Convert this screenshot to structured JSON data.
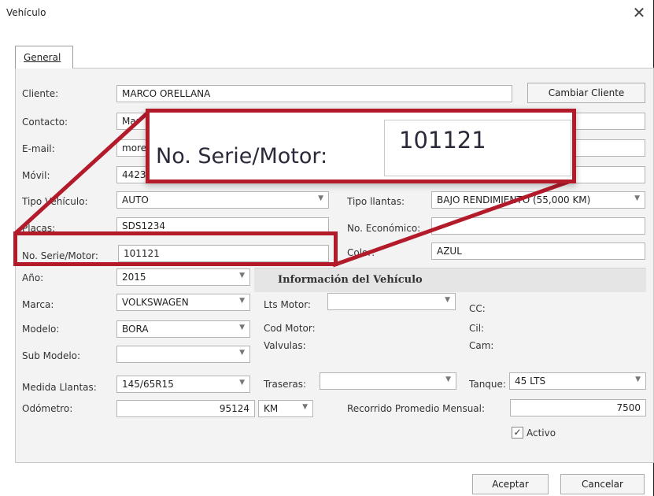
{
  "window": {
    "title": "Vehículo",
    "close_symbol": "✕"
  },
  "tabs": [
    {
      "label": "General"
    }
  ],
  "fields": {
    "cliente": {
      "label": "Cliente:",
      "value": "MARCO ORELLANA"
    },
    "contacto": {
      "label": "Contacto:",
      "value": "Mar"
    },
    "email": {
      "label": "E-mail:",
      "value": "more"
    },
    "movil": {
      "label": "Móvil:",
      "value": "4423"
    },
    "tipo_vehiculo": {
      "label": "Tipo Vehículo:",
      "value": "AUTO"
    },
    "placas": {
      "label": "Placas:",
      "value": "SDS1234"
    },
    "no_serie": {
      "label": "No. Serie/Motor:",
      "value": "101121"
    },
    "anio": {
      "label": "Año:",
      "value": "2015"
    },
    "marca": {
      "label": "Marca:",
      "value": "VOLKSWAGEN"
    },
    "modelo": {
      "label": "Modelo:",
      "value": "BORA"
    },
    "sub_modelo": {
      "label": "Sub Modelo:",
      "value": ""
    },
    "medida_llantas": {
      "label": "Medida Llantas:",
      "value": "145/65R15"
    },
    "odometro": {
      "label": "Odómetro:",
      "value": "95124",
      "unit": "KM"
    },
    "tipo_llantas": {
      "label": "Tipo llantas:",
      "value": "BAJO RENDIMIENTO (55,000 KM)"
    },
    "no_economico": {
      "label": "No. Económico:",
      "value": ""
    },
    "color": {
      "label": "Color:",
      "value": "AZUL"
    },
    "traseras": {
      "label": "Traseras:",
      "value": ""
    },
    "tanque": {
      "label": "Tanque:",
      "value": "45 LTS"
    },
    "recorrido": {
      "label": "Recorrido Promedio Mensual:",
      "value": "7500"
    }
  },
  "info": {
    "header": "Información del Vehículo",
    "lts_motor_label": "Lts Motor:",
    "lts_motor_value": "",
    "cod_motor_label": "Cod Motor:",
    "valvulas_label": "Valvulas:",
    "cc_label": "CC:",
    "cil_label": "Cil:",
    "cam_label": "Cam:"
  },
  "buttons": {
    "cambiar_cliente": "Cambiar Cliente",
    "aceptar": "Aceptar",
    "cancelar": "Cancelar"
  },
  "activo": {
    "label": "Activo",
    "checked": true,
    "check_symbol": "✓"
  },
  "callout": {
    "label": "No. Serie/Motor:",
    "value": "101121"
  },
  "colors": {
    "highlight": "#b31b2b"
  },
  "icons": {
    "close": "close-icon",
    "dropdown": "chevron-down-icon",
    "check": "checkmark-icon"
  }
}
